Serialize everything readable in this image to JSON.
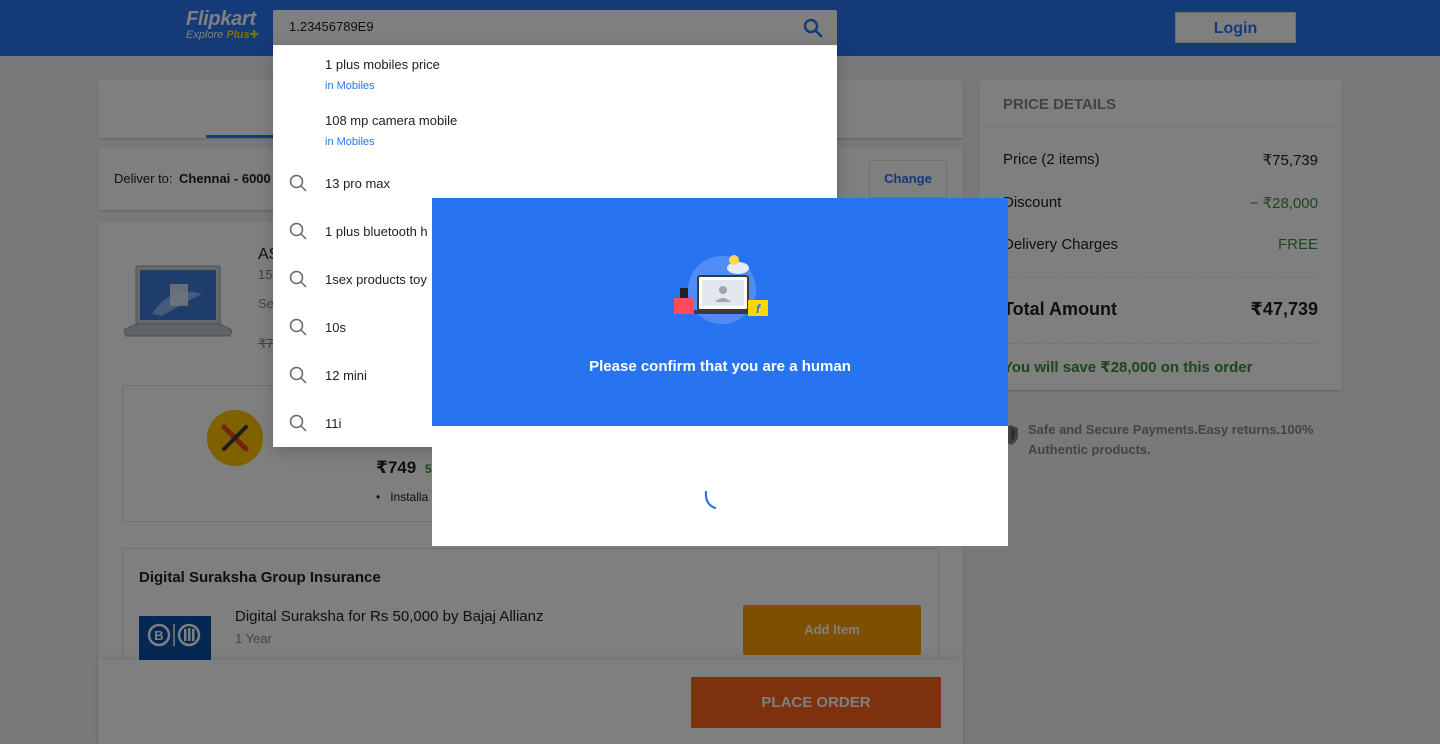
{
  "header": {
    "logo_main": "Flipkart",
    "logo_sub": "Explore",
    "logo_plus": "Plus",
    "search_value": "1.23456789E9",
    "login_label": "Login"
  },
  "delivery": {
    "label": "Deliver to:",
    "value": "Chennai - 6000",
    "change_label": "Change"
  },
  "item_fragments": {
    "title": "AS",
    "sub": "15",
    "seller": "Se",
    "old_price": "₹7"
  },
  "service": {
    "price": "₹749",
    "off": "5",
    "bullet": "Installa"
  },
  "insurance": {
    "title": "Digital Suraksha Group Insurance",
    "name": "Digital Suraksha for Rs 50,000 by Bajaj Allianz",
    "duration": "1 Year",
    "add_label": "Add Item"
  },
  "place_order_label": "PLACE ORDER",
  "price_details": {
    "heading": "PRICE DETAILS",
    "price_label": "Price (2 items)",
    "price_value": "₹75,739",
    "discount_label": "Discount",
    "discount_value": "− ₹28,000",
    "delivery_label": "Delivery Charges",
    "delivery_value": "FREE",
    "total_label": "Total Amount",
    "total_value": "₹47,739",
    "save_text": "You will save ₹28,000 on this order"
  },
  "secure_text": "Safe and Secure Payments.Easy returns.100% Authentic products.",
  "suggestions": [
    {
      "title": "1 plus mobiles price",
      "category": "in Mobiles",
      "icon": "none"
    },
    {
      "title": "108 mp camera mobile",
      "category": "in Mobiles",
      "icon": "none"
    },
    {
      "title": "13 pro max",
      "category": "",
      "icon": "search-icon"
    },
    {
      "title": "1 plus bluetooth h",
      "category": "",
      "icon": "search-icon"
    },
    {
      "title": "1sex products toy",
      "category": "",
      "icon": "search-icon"
    },
    {
      "title": "10s",
      "category": "",
      "icon": "search-icon"
    },
    {
      "title": "12 mini",
      "category": "",
      "icon": "search-icon"
    },
    {
      "title": "11i",
      "category": "",
      "icon": "search-icon"
    }
  ],
  "captcha": {
    "message": "Please confirm that you are a human"
  },
  "colors": {
    "brand_blue": "#2874f0",
    "accent_yellow": "#ffe500",
    "order_orange": "#fb641b",
    "add_orange": "#ff9f00",
    "success_green": "#388e3c"
  }
}
